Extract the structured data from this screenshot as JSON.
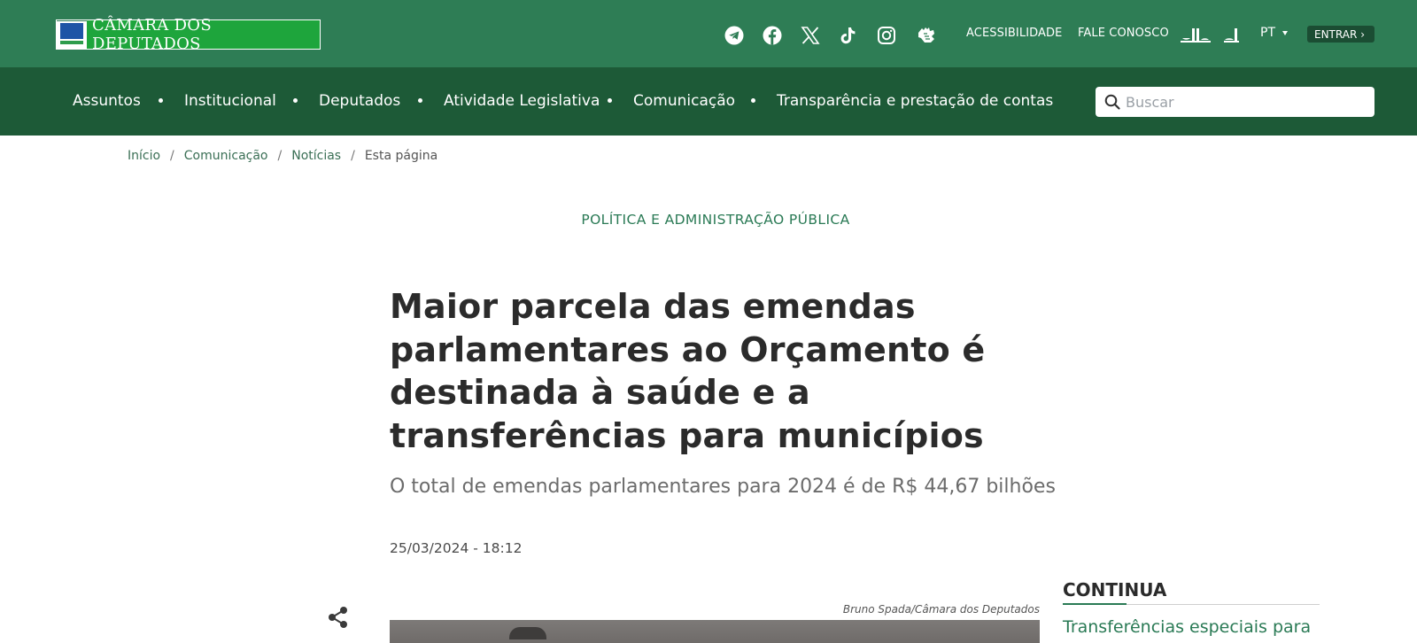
{
  "header": {
    "logo_text": "CÂMARA DOS DEPUTADOS",
    "social_icons": [
      "telegram-icon",
      "facebook-icon",
      "x-icon",
      "tiktok-icon",
      "instagram-icon",
      "sign-language-icon"
    ],
    "links": {
      "accessibility": "ACESSIBILIDADE",
      "contact": "FALE CONOSCO"
    },
    "language": "PT",
    "login": "ENTRAR"
  },
  "nav": {
    "items": [
      "Assuntos",
      "Institucional",
      "Deputados",
      "Atividade Legislativa",
      "Comunicação",
      "Transparência e prestação de contas"
    ],
    "search_placeholder": "Buscar"
  },
  "breadcrumb": {
    "items": [
      "Início",
      "Comunicação",
      "Notícias",
      "Esta página"
    ],
    "separator": "/"
  },
  "article": {
    "category": "POLÍTICA E ADMINISTRAÇÃO PÚBLICA",
    "title_lines": [
      "Maior parcela das emendas",
      "parlamentares ao Orçamento é",
      "destinada à saúde e a",
      "transferências para municípios"
    ],
    "subtitle": "O total de emendas parlamentares para 2024 é de R$ 44,67 bilhões",
    "date": "25/03/2024 - 18:12",
    "photo_credit": "Bruno Spada/Câmara dos Deputados"
  },
  "aside": {
    "title": "CONTINUA",
    "first_link": "Transferências especiais para"
  },
  "colors": {
    "topbar": "#2e7d55",
    "navbar": "#1d5a37",
    "accent_green": "#2a7a55",
    "logo_green": "#1ea53c"
  }
}
